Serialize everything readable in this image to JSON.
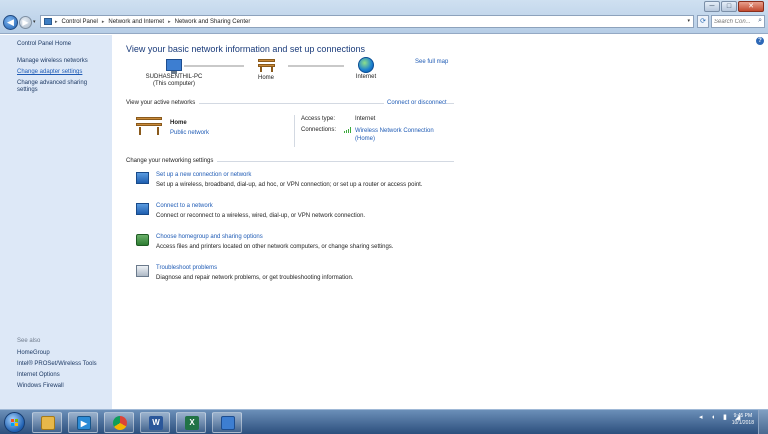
{
  "window": {
    "min_glyph": "─",
    "max_glyph": "□",
    "close_glyph": "✕"
  },
  "nav": {
    "back_glyph": "◀",
    "fwd_glyph": "▶",
    "breadcrumbs": [
      "Control Panel",
      "Network and Internet",
      "Network and Sharing Center"
    ],
    "separator": "▸",
    "search_placeholder": "Search Con..."
  },
  "sidebar": {
    "home": "Control Panel Home",
    "items": [
      {
        "label": "Manage wireless networks"
      },
      {
        "label": "Change adapter settings"
      },
      {
        "label": "Change advanced sharing settings"
      }
    ],
    "see_also_title": "See also",
    "see_also": [
      "HomeGroup",
      "Intel® PROSet/Wireless Tools",
      "Internet Options",
      "Windows Firewall"
    ]
  },
  "main": {
    "title": "View your basic network information and set up connections",
    "see_full_map": "See full map",
    "map": {
      "computer_name": "SUDHASENTHIL-PC",
      "computer_sub": "(This computer)",
      "network": "Home",
      "internet": "Internet"
    },
    "active_networks_label": "View your active networks",
    "connect_disconnect": "Connect or disconnect",
    "active_network": {
      "name": "Home",
      "type": "Public network",
      "access_type_label": "Access type:",
      "access_type_value": "Internet",
      "connections_label": "Connections:",
      "connections_value": "Wireless Network Connection (Home)"
    },
    "change_settings_label": "Change your networking settings",
    "tasks": [
      {
        "link": "Set up a new connection or network",
        "desc": "Set up a wireless, broadband, dial-up, ad hoc, or VPN connection; or set up a router or access point."
      },
      {
        "link": "Connect to a network",
        "desc": "Connect or reconnect to a wireless, wired, dial-up, or VPN network connection."
      },
      {
        "link": "Choose homegroup and sharing options",
        "desc": "Access files and printers located on other network computers, or change sharing settings."
      },
      {
        "link": "Troubleshoot problems",
        "desc": "Diagnose and repair network problems, or get troubleshooting information."
      }
    ]
  },
  "taskbar": {
    "apps": [
      {
        "name": "folder",
        "glyph": ""
      },
      {
        "name": "media",
        "glyph": "▶"
      },
      {
        "name": "chrome",
        "glyph": ""
      },
      {
        "name": "word",
        "glyph": "W"
      },
      {
        "name": "excel",
        "glyph": "X"
      },
      {
        "name": "network",
        "glyph": ""
      }
    ],
    "time": "9:45 PM",
    "date": "10/1/2018"
  },
  "colors": {
    "link": "#1f5bb5",
    "sidebar_bg": "#dde8f7",
    "title": "#1a3b7a"
  }
}
